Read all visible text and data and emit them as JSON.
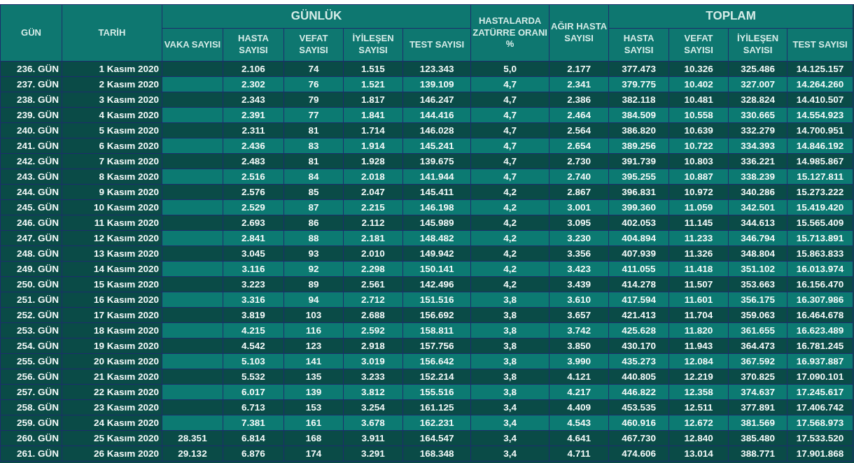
{
  "header": {
    "day": "GÜN",
    "date": "TARİH",
    "daily_group": "GÜNLÜK",
    "daily_columns": [
      "VAKA SAYISI",
      "HASTA SAYISI",
      "VEFAT SAYISI",
      "İYİLEŞEN SAYISI",
      "TEST SAYISI"
    ],
    "pneumonia": "HASTALARDA ZATÜRRE ORANI %",
    "severe": "AĞIR HASTA SAYISI",
    "total_group": "TOPLAM",
    "total_columns": [
      "HASTA SAYISI",
      "VEFAT SAYISI",
      "İYİLEŞEN SAYISI",
      "TEST SAYISI"
    ]
  },
  "rows": [
    {
      "day": "236. GÜN",
      "date": "1 Kasım 2020",
      "values": [
        "2.106",
        "74",
        "1.515",
        "123.343",
        "5,0",
        "2.177",
        "377.473",
        "10.326",
        "325.486",
        "14.125.157"
      ],
      "shaded": false
    },
    {
      "day": "237. GÜN",
      "date": "2 Kasım 2020",
      "values": [
        "2.302",
        "76",
        "1.521",
        "139.109",
        "4,7",
        "2.341",
        "379.775",
        "10.402",
        "327.007",
        "14.264.260"
      ],
      "shaded": true
    },
    {
      "day": "238. GÜN",
      "date": "3 Kasım 2020",
      "values": [
        "2.343",
        "79",
        "1.817",
        "146.247",
        "4,7",
        "2.386",
        "382.118",
        "10.481",
        "328.824",
        "14.410.507"
      ],
      "shaded": false
    },
    {
      "day": "239. GÜN",
      "date": "4 Kasım 2020",
      "values": [
        "2.391",
        "77",
        "1.841",
        "144.416",
        "4,7",
        "2.464",
        "384.509",
        "10.558",
        "330.665",
        "14.554.923"
      ],
      "shaded": true
    },
    {
      "day": "240. GÜN",
      "date": "5 Kasım 2020",
      "values": [
        "2.311",
        "81",
        "1.714",
        "146.028",
        "4,7",
        "2.564",
        "386.820",
        "10.639",
        "332.279",
        "14.700.951"
      ],
      "shaded": false
    },
    {
      "day": "241. GÜN",
      "date": "6 Kasım 2020",
      "values": [
        "2.436",
        "83",
        "1.914",
        "145.241",
        "4,7",
        "2.654",
        "389.256",
        "10.722",
        "334.393",
        "14.846.192"
      ],
      "shaded": true
    },
    {
      "day": "242. GÜN",
      "date": "7 Kasım 2020",
      "values": [
        "2.483",
        "81",
        "1.928",
        "139.675",
        "4,7",
        "2.730",
        "391.739",
        "10.803",
        "336.221",
        "14.985.867"
      ],
      "shaded": false
    },
    {
      "day": "243. GÜN",
      "date": "8 Kasım 2020",
      "values": [
        "2.516",
        "84",
        "2.018",
        "141.944",
        "4,7",
        "2.740",
        "395.255",
        "10.887",
        "338.239",
        "15.127.811"
      ],
      "shaded": true
    },
    {
      "day": "244. GÜN",
      "date": "9 Kasım 2020",
      "values": [
        "2.576",
        "85",
        "2.047",
        "145.411",
        "4,2",
        "2.867",
        "396.831",
        "10.972",
        "340.286",
        "15.273.222"
      ],
      "shaded": false
    },
    {
      "day": "245. GÜN",
      "date": "10 Kasım 2020",
      "values": [
        "2.529",
        "87",
        "2.215",
        "146.198",
        "4,2",
        "3.001",
        "399.360",
        "11.059",
        "342.501",
        "15.419.420"
      ],
      "shaded": true
    },
    {
      "day": "246. GÜN",
      "date": "11 Kasım 2020",
      "values": [
        "2.693",
        "86",
        "2.112",
        "145.989",
        "4,2",
        "3.095",
        "402.053",
        "11.145",
        "344.613",
        "15.565.409"
      ],
      "shaded": false
    },
    {
      "day": "247. GÜN",
      "date": "12 Kasım 2020",
      "values": [
        "2.841",
        "88",
        "2.181",
        "148.482",
        "4,2",
        "3.230",
        "404.894",
        "11.233",
        "346.794",
        "15.713.891"
      ],
      "shaded": true
    },
    {
      "day": "248. GÜN",
      "date": "13 Kasım 2020",
      "values": [
        "3.045",
        "93",
        "2.010",
        "149.942",
        "4,2",
        "3.356",
        "407.939",
        "11.326",
        "348.804",
        "15.863.833"
      ],
      "shaded": false
    },
    {
      "day": "249. GÜN",
      "date": "14 Kasım 2020",
      "values": [
        "3.116",
        "92",
        "2.298",
        "150.141",
        "4,2",
        "3.423",
        "411.055",
        "11.418",
        "351.102",
        "16.013.974"
      ],
      "shaded": true
    },
    {
      "day": "250. GÜN",
      "date": "15 Kasım 2020",
      "values": [
        "3.223",
        "89",
        "2.561",
        "142.496",
        "4,2",
        "3.439",
        "414.278",
        "11.507",
        "353.663",
        "16.156.470"
      ],
      "shaded": false
    },
    {
      "day": "251. GÜN",
      "date": "16 Kasım 2020",
      "values": [
        "3.316",
        "94",
        "2.712",
        "151.516",
        "3,8",
        "3.610",
        "417.594",
        "11.601",
        "356.175",
        "16.307.986"
      ],
      "shaded": true
    },
    {
      "day": "252. GÜN",
      "date": "17 Kasım 2020",
      "values": [
        "3.819",
        "103",
        "2.688",
        "156.692",
        "3,8",
        "3.657",
        "421.413",
        "11.704",
        "359.063",
        "16.464.678"
      ],
      "shaded": false
    },
    {
      "day": "253. GÜN",
      "date": "18 Kasım 2020",
      "values": [
        "4.215",
        "116",
        "2.592",
        "158.811",
        "3,8",
        "3.742",
        "425.628",
        "11.820",
        "361.655",
        "16.623.489"
      ],
      "shaded": true
    },
    {
      "day": "254. GÜN",
      "date": "19 Kasım 2020",
      "values": [
        "4.542",
        "123",
        "2.918",
        "157.756",
        "3,8",
        "3.850",
        "430.170",
        "11.943",
        "364.473",
        "16.781.245"
      ],
      "shaded": false
    },
    {
      "day": "255. GÜN",
      "date": "20 Kasım 2020",
      "values": [
        "5.103",
        "141",
        "3.019",
        "156.642",
        "3,8",
        "3.990",
        "435.273",
        "12.084",
        "367.592",
        "16.937.887"
      ],
      "shaded": true
    },
    {
      "day": "256. GÜN",
      "date": "21 Kasım 2020",
      "values": [
        "5.532",
        "135",
        "3.233",
        "152.214",
        "3,8",
        "4.121",
        "440.805",
        "12.219",
        "370.825",
        "17.090.101"
      ],
      "shaded": false
    },
    {
      "day": "257. GÜN",
      "date": "22 Kasım 2020",
      "values": [
        "6.017",
        "139",
        "3.812",
        "155.516",
        "3,8",
        "4.217",
        "446.822",
        "12.358",
        "374.637",
        "17.245.617"
      ],
      "shaded": true
    },
    {
      "day": "258. GÜN",
      "date": "23 Kasım 2020",
      "values": [
        "6.713",
        "153",
        "3.254",
        "161.125",
        "3,4",
        "4.409",
        "453.535",
        "12.511",
        "377.891",
        "17.406.742"
      ],
      "shaded": false
    },
    {
      "day": "259. GÜN",
      "date": "24 Kasım 2020",
      "values": [
        "7.381",
        "161",
        "3.678",
        "162.231",
        "3,4",
        "4.543",
        "460.916",
        "12.672",
        "381.569",
        "17.568.973"
      ],
      "shaded": true
    },
    {
      "day": "260. GÜN",
      "date": "25 Kasım 2020",
      "cases": "28.351",
      "values": [
        "6.814",
        "168",
        "3.911",
        "164.547",
        "3,4",
        "4.641",
        "467.730",
        "12.840",
        "385.480",
        "17.533.520"
      ],
      "shaded": false
    },
    {
      "day": "261. GÜN",
      "date": "26 Kasım 2020",
      "cases": "29.132",
      "values": [
        "6.876",
        "174",
        "3.291",
        "168.348",
        "3,4",
        "4.711",
        "474.606",
        "13.014",
        "388.771",
        "17.901.868"
      ],
      "shaded": false
    }
  ]
}
